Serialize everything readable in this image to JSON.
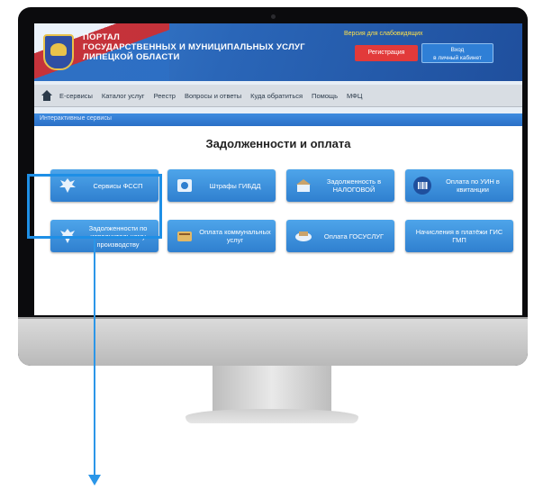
{
  "header": {
    "title_line1": "ПОРТАЛ",
    "title_line2": "ГОСУДАРСТВЕННЫХ И МУНИЦИПАЛЬНЫХ УСЛУГ",
    "title_line3": "ЛИПЕЦКОЙ ОБЛАСТИ",
    "vision_link": "Версия для слабовидящих",
    "register_label": "Регистрация",
    "login_line1": "Вход",
    "login_line2": "в личный кабинет"
  },
  "nav": {
    "items": [
      "Е-сервисы",
      "Каталог услуг",
      "Реестр",
      "Вопросы и ответы",
      "Куда обратиться",
      "Помощь",
      "МФЦ"
    ]
  },
  "section": {
    "label": "Интерактивные сервисы"
  },
  "content": {
    "title": "Задолженности и оплата"
  },
  "services": [
    {
      "label": "Сервисы ФССП",
      "icon": "eagle-emblem-icon"
    },
    {
      "label": "Штрафы ГИБДД",
      "icon": "traffic-police-icon"
    },
    {
      "label": "Задолженность в НАЛОГОВОЙ",
      "icon": "tax-office-icon"
    },
    {
      "label": "Оплата по УИН в квитанции",
      "icon": "barcode-icon"
    },
    {
      "label": "Задолженности по исполнительному производству",
      "icon": "eagle-emblem-icon"
    },
    {
      "label": "Оплата коммунальных услуг",
      "icon": "utilities-icon"
    },
    {
      "label": "Оплата ГОСУСЛУГ",
      "icon": "payment-icon"
    },
    {
      "label": "Начисления в платёжи ГИС ГМП",
      "icon": "none"
    }
  ],
  "colors": {
    "header_blue": "#2a66b8",
    "button_blue": "#2f7fcf",
    "register_red": "#e23a3a",
    "highlight": "#1e8fe6"
  }
}
